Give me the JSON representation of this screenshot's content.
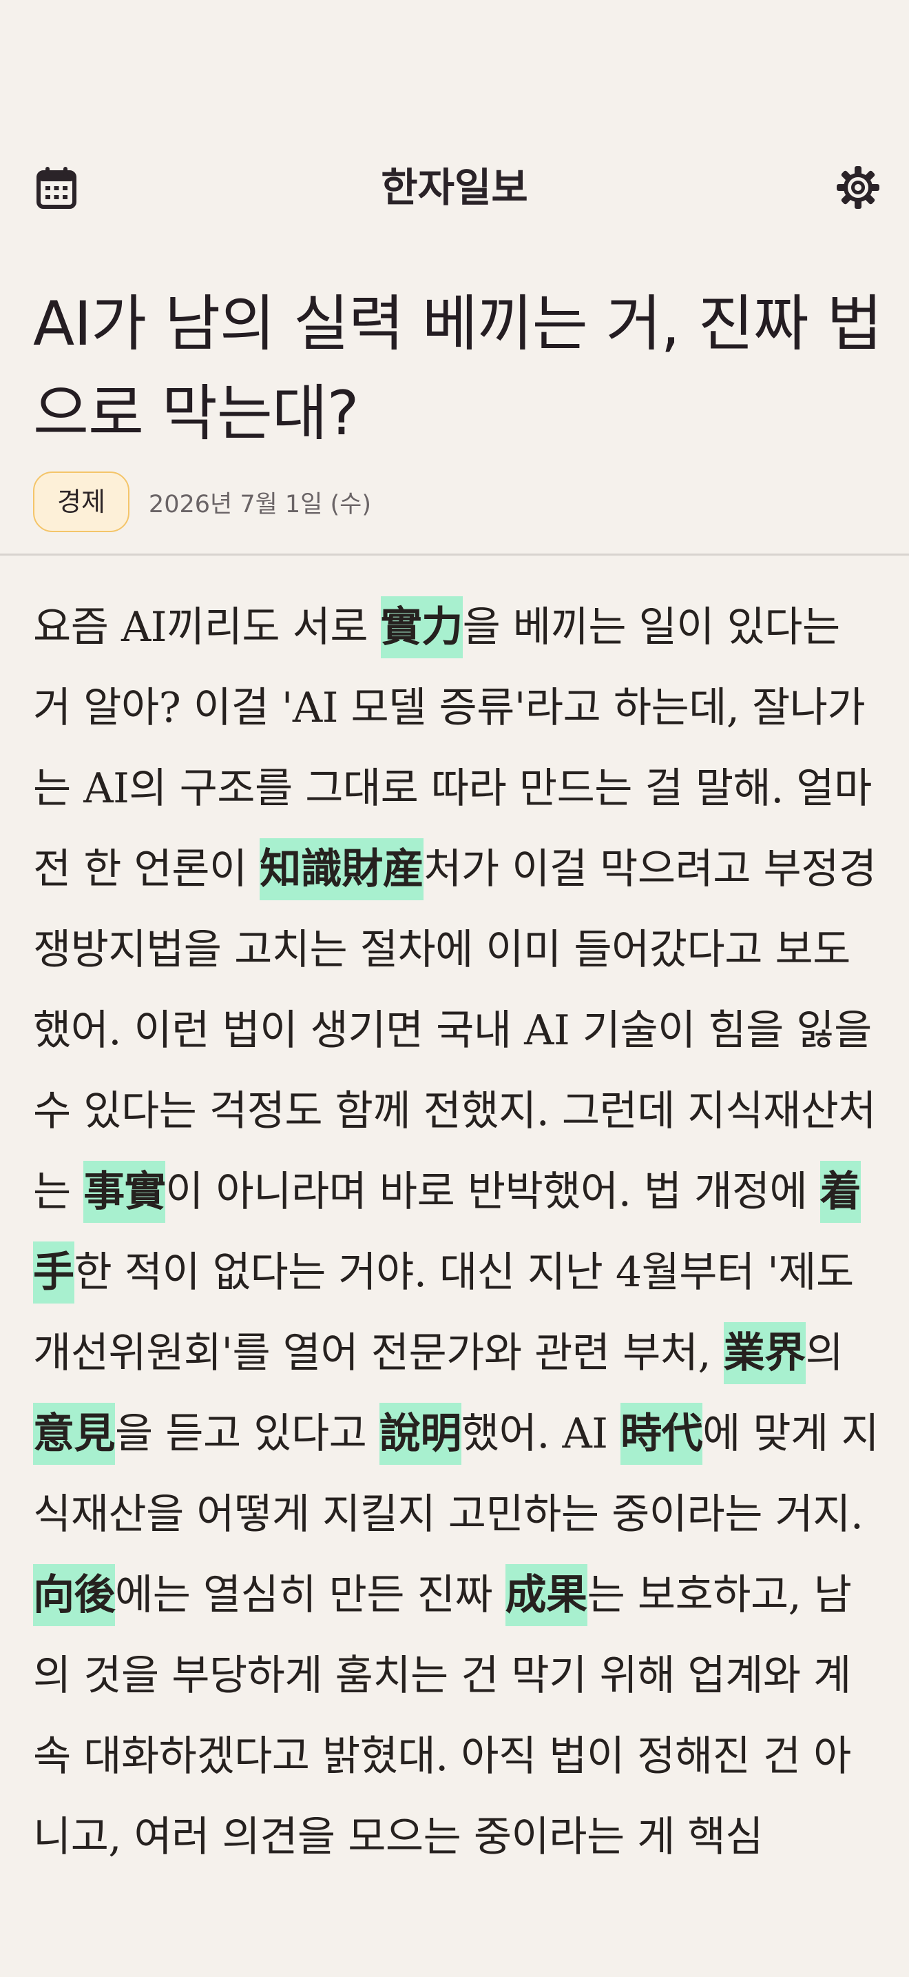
{
  "header": {
    "title": "한자일보",
    "left_icon": "calendar-icon",
    "right_icon": "gear-icon"
  },
  "article": {
    "headline": "AI가 남의 실력 베끼는 거, 진짜 법으로 막는대?",
    "category": "경제",
    "date": "2026년 7월 1일 (수)",
    "segments": [
      {
        "text": "요즘 AI끼리도 서로 "
      },
      {
        "text": "實力",
        "hanja": true
      },
      {
        "text": "을 베끼는 일이 있다는 거 알아? 이걸 'AI 모델 증류'라고 하는데, 잘나가는 AI의 구조를 그대로 따라 만드는 걸 말해. 얼마 전 한 언론이 "
      },
      {
        "text": "知識財産",
        "hanja": true
      },
      {
        "text": "처가 이걸 막으려고 부정경쟁방지법을 고치는 절차에 이미 들어갔다고 보도했어. 이런 법이 생기면 국내 AI 기술이 힘을 잃을 수 있다는 걱정도 함께 전했지. 그런데 지식재산처는 "
      },
      {
        "text": "事實",
        "hanja": true
      },
      {
        "text": "이 아니라며 바로 반박했어. 법 개정에 "
      },
      {
        "text": "着手",
        "hanja": true
      },
      {
        "text": "한 적이 없다는 거야. 대신 지난 4월부터 '제도개선위원회'를 열어 전문가와 관련 부처, "
      },
      {
        "text": "業界",
        "hanja": true
      },
      {
        "text": "의 "
      },
      {
        "text": "意見",
        "hanja": true
      },
      {
        "text": "을 듣고 있다고 "
      },
      {
        "text": "說明",
        "hanja": true
      },
      {
        "text": "했어. AI "
      },
      {
        "text": "時代",
        "hanja": true
      },
      {
        "text": "에 맞게 지식재산을 어떻게 지킬지 고민하는 중이라는 거지. "
      },
      {
        "text": "向後",
        "hanja": true
      },
      {
        "text": "에는 열심히 만든 진짜 "
      },
      {
        "text": "成果",
        "hanja": true
      },
      {
        "text": "는 보호하고, 남의 것을 부당하게 훔치는 건 막기 위해 업계와 계속 대화하겠다고 밝혔대. 아직 법이 정해진 건 아니고, 여러 의견을 모으는 중이라는 게 핵심"
      }
    ]
  },
  "colors": {
    "background": "#f5f1ec",
    "hanja_highlight": "#a8f0cf",
    "category_fill": "#fdf0d8",
    "category_border": "#f4c56a"
  }
}
